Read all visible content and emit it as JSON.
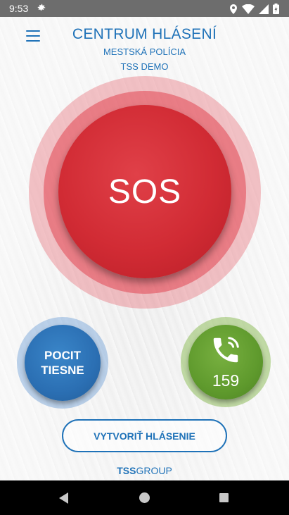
{
  "status_bar": {
    "time": "9:53",
    "icons": [
      "gear-icon",
      "location-icon",
      "wifi-icon",
      "signal-icon",
      "battery-icon"
    ]
  },
  "header": {
    "title": "CENTRUM HLÁSENÍ",
    "subtitle": "MESTSKÁ POLÍCIA",
    "subtitle2": "TSS DEMO",
    "menu_icon": "hamburger-menu-icon"
  },
  "sos": {
    "label": "SOS",
    "color": "#d12b34"
  },
  "distress": {
    "line1": "POCIT",
    "line2": "TIESNE",
    "color": "#2b6fb3"
  },
  "call": {
    "number": "159",
    "icon": "phone-icon",
    "color": "#5f9a2d"
  },
  "report_button": {
    "label": "VYTVORIŤ HLÁSENIE"
  },
  "brand": {
    "bold": "TSS",
    "rest": "GROUP"
  },
  "colors": {
    "accent": "#1f72b8"
  },
  "nav_bar": {
    "icons": [
      "back-icon",
      "home-icon",
      "recents-icon"
    ]
  }
}
